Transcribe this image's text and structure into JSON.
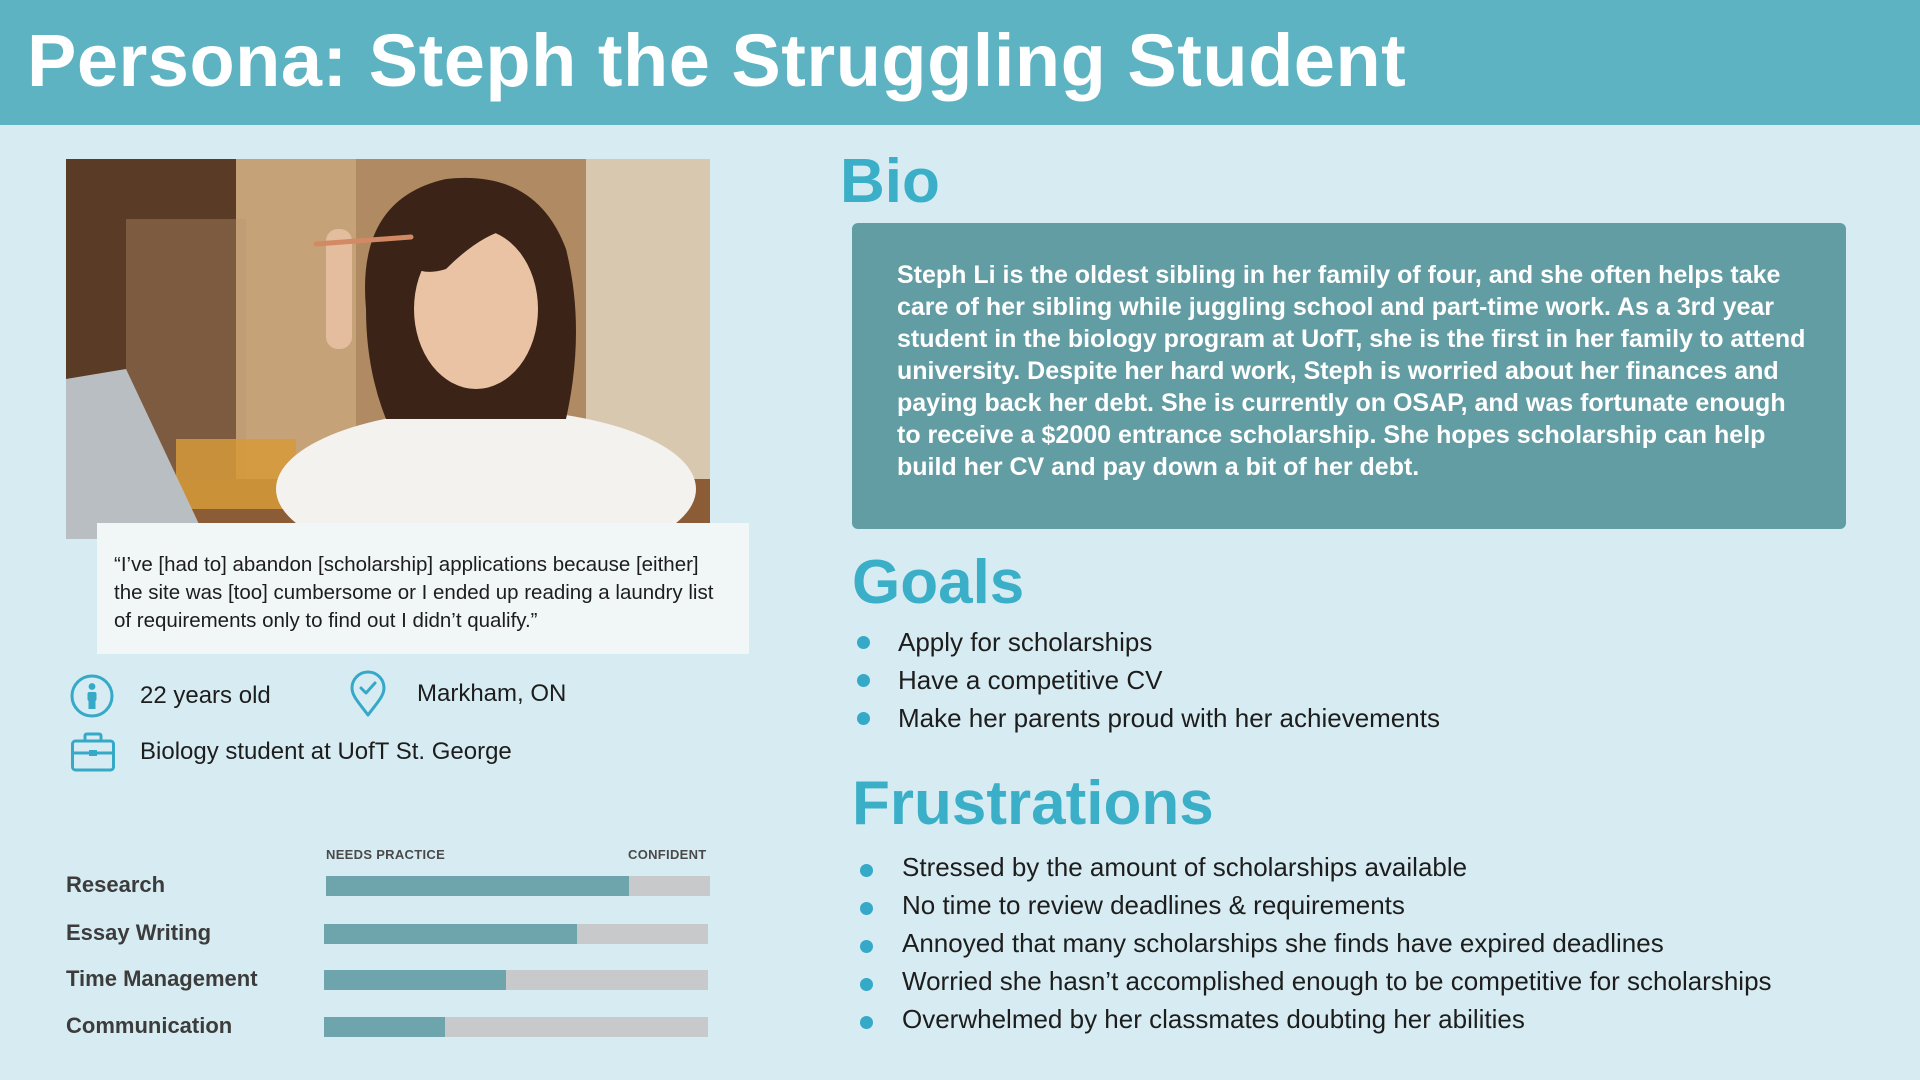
{
  "header": {
    "title": "Persona: Steph the Struggling Student"
  },
  "quote": "“I’ve [had to] abandon [scholarship] applications because [either] the site was [too] cumbersome or I ended up reading a laundry list of requirements only to find out I didn’t qualify.”",
  "profile": {
    "age": "22 years old",
    "location": "Markham, ON",
    "occupation": "Biology student at UofT St. George",
    "icons": {
      "age": "person-icon",
      "location": "location-pin-check-icon",
      "occupation": "briefcase-icon"
    }
  },
  "skills": {
    "low_label": "NEEDS PRACTICE",
    "high_label": "CONFIDENT",
    "items": [
      {
        "label": "Research",
        "level": 0.79
      },
      {
        "label": "Essay Writing",
        "level": 0.66
      },
      {
        "label": "Time Management",
        "level": 0.475
      },
      {
        "label": "Communication",
        "level": 0.315
      }
    ]
  },
  "bio": {
    "title": "Bio",
    "text": "Steph Li is the oldest sibling in her family of four, and she often helps take care of her sibling while juggling school and part-time work.  As a 3rd year student in the biology program at UofT, she is the first in her family to attend university. Despite her hard work, Steph is worried about her finances and paying back her debt. She is currently on OSAP, and was fortunate enough to receive a $2000 entrance scholarship. She hopes scholarship can help build her CV and pay down a bit of her debt."
  },
  "goals": {
    "title": "Goals",
    "items": [
      "Apply for scholarships",
      "Have a competitive CV",
      "Make her parents proud with her achievements"
    ]
  },
  "frustrations": {
    "title": "Frustrations",
    "items": [
      "Stressed by the amount of scholarships available",
      "No time to review deadlines & requirements",
      "Annoyed that many scholarships she finds have expired deadlines",
      "Worried she hasn’t accomplished enough to be competitive for scholarships",
      "Overwhelmed by her classmates doubting her abilities"
    ]
  },
  "colors": {
    "header": "#5db3c1",
    "background": "#d7ecf2",
    "accent": "#3aafc7",
    "bio_box": "#639da4",
    "skill_fill": "#6ea5ad",
    "skill_track": "#c7c9ca"
  }
}
